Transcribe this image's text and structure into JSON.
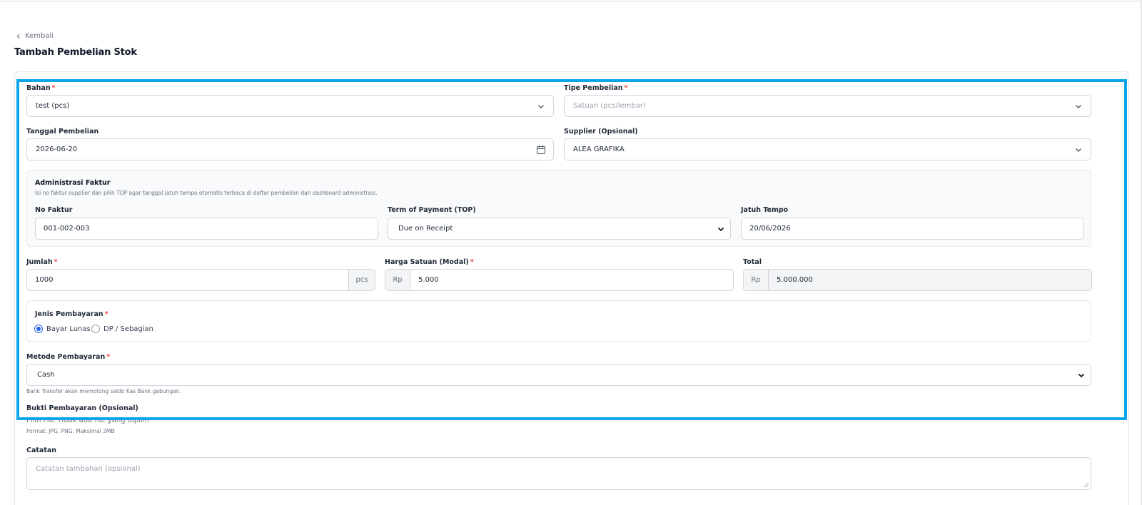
{
  "back": {
    "label": "Kembali"
  },
  "page": {
    "title": "Tambah Pembelian Stok"
  },
  "form": {
    "bahan": {
      "label": "Bahan",
      "value": "test (pcs)"
    },
    "tipe_pembelian": {
      "label": "Tipe Pembelian",
      "placeholder": "Satuan (pcs/lembar)"
    },
    "tanggal_pembelian": {
      "label": "Tanggal Pembelian",
      "value": "2026-06-20"
    },
    "supplier": {
      "label": "Supplier (Opsional)",
      "value": "ALEA GRAFIKA"
    },
    "administrasi": {
      "title": "Administrasi Faktur",
      "description": "Isi no faktur supplier dan pilih TOP agar tanggal jatuh tempo otomatis terbaca di daftar pembelian dan dashboard administrasi.",
      "no_faktur": {
        "label": "No Faktur",
        "value": "001-002-003"
      },
      "top": {
        "label": "Term of Payment (TOP)",
        "value": "Due on Receipt"
      },
      "jatuh_tempo": {
        "label": "Jatuh Tempo",
        "value": "20/06/2026"
      }
    },
    "jumlah": {
      "label": "Jumlah",
      "value": "1000",
      "unit": "pcs"
    },
    "harga_satuan": {
      "label": "Harga Satuan (Modal)",
      "prefix": "Rp",
      "value": "5.000"
    },
    "total": {
      "label": "Total",
      "prefix": "Rp",
      "value": "5.000.000"
    },
    "jenis_pembayaran": {
      "label": "Jenis Pembayaran",
      "options": [
        "Bayar Lunas",
        "DP / Sebagian"
      ],
      "selected": "Bayar Lunas"
    },
    "metode_pembayaran": {
      "label": "Metode Pembayaran",
      "value": "Cash",
      "hint": "Bank Transfer akan memotong saldo Kas Bank gabungan."
    },
    "bukti": {
      "label": "Bukti Pembayaran (Opsional)",
      "button": "Pilih File",
      "status": "Tidak ada file yang dipilih",
      "hint": "Format: JPG, PNG. Maksimal 2MB"
    },
    "catatan": {
      "label": "Catatan",
      "placeholder": "Catatan tambahan (opsional)"
    }
  },
  "colors": {
    "highlight": "#0ea5e9",
    "required": "#ef4444",
    "radio": "#2563eb"
  }
}
